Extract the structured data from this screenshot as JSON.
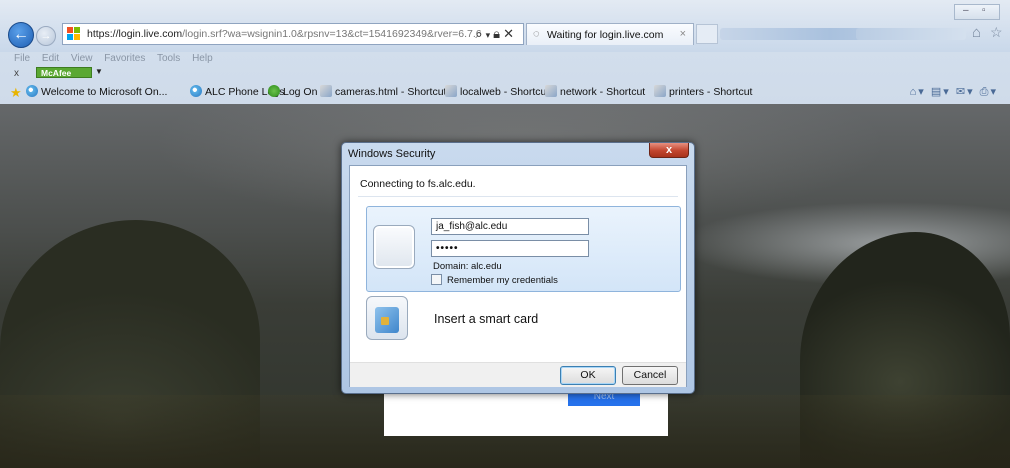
{
  "browser": {
    "address": {
      "url_main": "https://login.live.com",
      "url_rest": "/login.srf?wa=wsignin1.0&rpsnv=13&ct=1541692349&rver=6.7.6"
    },
    "tab": {
      "label": "Waiting for login.live.com"
    },
    "menu": [
      "File",
      "Edit",
      "View",
      "Favorites",
      "Tools",
      "Help"
    ],
    "addon": {
      "close": "x",
      "mcafee_label": "McAfee"
    },
    "favorites": [
      {
        "label": "Welcome to Microsoft On..."
      },
      {
        "label": "ALC Phone Logs"
      },
      {
        "label": "Log On"
      },
      {
        "label": "cameras.html - Shortcut"
      },
      {
        "label": "localweb - Shortcut"
      },
      {
        "label": "network - Shortcut"
      },
      {
        "label": "printers - Shortcut"
      }
    ]
  },
  "page": {
    "next_label": "Next"
  },
  "dialog": {
    "title": "Windows Security",
    "close": "x",
    "subtitle": "Connecting to fs.alc.edu.",
    "username": "ja_fish@alc.edu",
    "password_mask": "•••••",
    "domain": "Domain: alc.edu",
    "remember": "Remember my credentials",
    "smartcard": "Insert a smart card",
    "ok": "OK",
    "cancel": "Cancel"
  }
}
